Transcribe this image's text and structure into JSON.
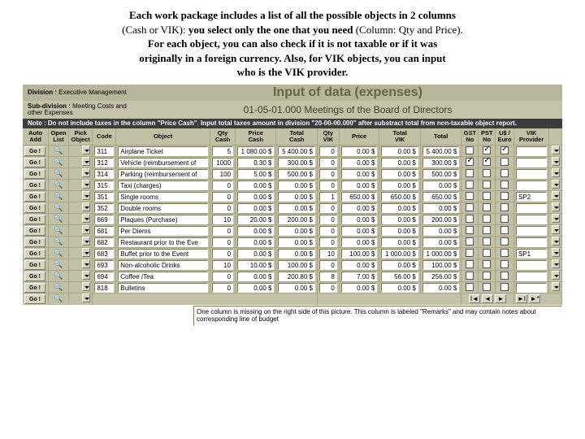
{
  "intro": {
    "l1a": "Each work package includes a list of all the possible objects in 2 columns",
    "l2p1": "(Cash or VIK): ",
    "l2b": "you select only the one that you need",
    "l2p2": " (Column: Qty and Price).",
    "l3": "For each object, you can also check if it is not taxable or if it was",
    "l4": "originally in a foreign currency. Also, for VIK objects, you can input",
    "l5": "who is the VIK provider."
  },
  "header": {
    "divisionLabel": "Division :",
    "divisionValue": "Executive Management",
    "bigTitle": "Input of data (expenses)",
    "subLabel": "Sub-division :",
    "subValue": "Meeting Costs and other Expenses",
    "subtitle": "01-05-01.000 Meetings of the Board of Directors",
    "noteLabel": "Note :",
    "noteText": "Do not include taxes in the column \"Price Cash\". Input total taxes amount in division \"20-00-00.000\" after substract total from non-taxable object report."
  },
  "cols": {
    "auto": "Auto\nAdd",
    "open": "Open\nList",
    "pick": "Pick\nObject",
    "code": "Code",
    "obj": "Object",
    "qtyc": "Qty\nCash",
    "pricec": "Price\nCash",
    "totc": "Total\nCash",
    "qtyv": "Qty\nVIK",
    "pricev": "Price",
    "totv": "Total\nVIK",
    "total": "Total",
    "gst": "GST\nNo",
    "pst": "PST\nNo",
    "use": "U$ /\nEuro",
    "vikp": "VIK\nProvider"
  },
  "go": "Go !",
  "rows": [
    {
      "code": "311",
      "obj": "Airplane Ticket",
      "qtyc": "5",
      "pricec": "1 080.00 $",
      "totc": "5 400.00 $",
      "qtyv": "0",
      "pricev": "0.00 $",
      "totv": "0.00 $",
      "total": "5 400.00 $",
      "gst": false,
      "pst": true,
      "use": true,
      "vikp": ""
    },
    {
      "code": "312",
      "obj": "Vehicle (reimbursement of",
      "qtyc": "1000",
      "pricec": "0.30 $",
      "totc": "300.00 $",
      "qtyv": "0",
      "pricev": "0.00 $",
      "totv": "0.00 $",
      "total": "300.00 $",
      "gst": true,
      "pst": true,
      "use": false,
      "vikp": ""
    },
    {
      "code": "314",
      "obj": "Parking (reimbursement of",
      "qtyc": "100",
      "pricec": "5.00 $",
      "totc": "500.00 $",
      "qtyv": "0",
      "pricev": "0.00 $",
      "totv": "0.00 $",
      "total": "500.00 $",
      "gst": false,
      "pst": false,
      "use": false,
      "vikp": ""
    },
    {
      "code": "315",
      "obj": "Taxi (charges)",
      "qtyc": "0",
      "pricec": "0.00 $",
      "totc": "0.00 $",
      "qtyv": "0",
      "pricev": "0.00 $",
      "totv": "0.00 $",
      "total": "0.00 $",
      "gst": false,
      "pst": false,
      "use": false,
      "vikp": ""
    },
    {
      "code": "351",
      "obj": "Single rooms",
      "qtyc": "0",
      "pricec": "0.00 $",
      "totc": "0.00 $",
      "qtyv": "1",
      "pricev": "650.00 $",
      "totv": "650.00 $",
      "total": "650.00 $",
      "gst": false,
      "pst": false,
      "use": false,
      "vikp": "SP2"
    },
    {
      "code": "352",
      "obj": "Double rooms",
      "qtyc": "0",
      "pricec": "0.00 $",
      "totc": "0.00 $",
      "qtyv": "0",
      "pricev": "0.00 $",
      "totv": "0.00 $",
      "total": "0.00 $",
      "gst": false,
      "pst": false,
      "use": false,
      "vikp": ""
    },
    {
      "code": "669",
      "obj": "Plaques (Purchase)",
      "qtyc": "10",
      "pricec": "20.00 $",
      "totc": "200.00 $",
      "qtyv": "0",
      "pricev": "0.00 $",
      "totv": "0.00 $",
      "total": "200.00 $",
      "gst": false,
      "pst": false,
      "use": false,
      "vikp": ""
    },
    {
      "code": "681",
      "obj": "Per Diems",
      "qtyc": "0",
      "pricec": "0.00 $",
      "totc": "0.00 $",
      "qtyv": "0",
      "pricev": "0.00 $",
      "totv": "0.00 $",
      "total": "0.00 $",
      "gst": false,
      "pst": false,
      "use": false,
      "vikp": ""
    },
    {
      "code": "682",
      "obj": "Restaurant prior to the Eve",
      "qtyc": "0",
      "pricec": "0.00 $",
      "totc": "0.00 $",
      "qtyv": "0",
      "pricev": "0.00 $",
      "totv": "0.00 $",
      "total": "0.00 $",
      "gst": false,
      "pst": false,
      "use": false,
      "vikp": ""
    },
    {
      "code": "683",
      "obj": "Buffet prior to the Event",
      "qtyc": "0",
      "pricec": "0.00 $",
      "totc": "0.00 $",
      "qtyv": "10",
      "pricev": "100.00 $",
      "totv": "1 000.00 $",
      "total": "1 000.00 $",
      "gst": false,
      "pst": false,
      "use": false,
      "vikp": "SP1"
    },
    {
      "code": "693",
      "obj": "Non-alcoholic Drinks",
      "qtyc": "10",
      "pricec": "10.00 $",
      "totc": "100.00 $",
      "qtyv": "0",
      "pricev": "0.00 $",
      "totv": "0.00 $",
      "total": "100.00 $",
      "gst": false,
      "pst": false,
      "use": false,
      "vikp": ""
    },
    {
      "code": "694",
      "obj": "Coffee /Tea",
      "qtyc": "0",
      "pricec": "0.00 $",
      "totc": "200.80 $",
      "qtyv": "8",
      "pricev": "7.00 $",
      "totv": "56.00 $",
      "total": "256.00 $",
      "gst": false,
      "pst": false,
      "use": false,
      "vikp": ""
    },
    {
      "code": "818",
      "obj": "Bulletins",
      "qtyc": "0",
      "pricec": "0.00 $",
      "totc": "0.00 $",
      "qtyv": "0",
      "pricev": "0.00 $",
      "totv": "0.00 $",
      "total": "0.00 $",
      "gst": false,
      "pst": false,
      "use": false,
      "vikp": ""
    }
  ],
  "footnote": "One column is missing on the right side of this picture. This column is labeled \"Remarks\" and may contain notes about corresponding line of budget",
  "nav": {
    "first": "I◄",
    "prev": "◄",
    "next": "►",
    "last": "►I",
    "add": "►*"
  }
}
